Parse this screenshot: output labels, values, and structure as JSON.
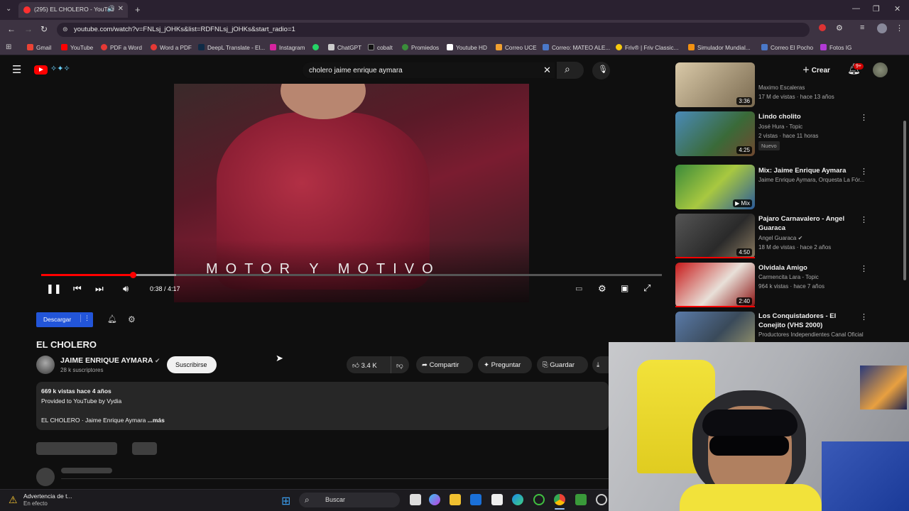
{
  "browser": {
    "tab_title": "(295) EL CHOLERO - YouTub",
    "url": "youtube.com/watch?v=FNLsj_jOHKs&list=RDFNLsj_jOHKs&start_radio=1",
    "bookmarks": [
      "Gmail",
      "YouTube",
      "PDF a Word",
      "Word a PDF",
      "DeepL Translate - El...",
      "Instagram",
      "ChatGPT",
      "cobalt",
      "Promiedos",
      "Youtube HD",
      "Correo UCE",
      "Correo: MATEO ALE...",
      "Friv® | Friv Classic...",
      "Simulador Mundial...",
      "Correo El Pocho",
      "Fotos IG"
    ]
  },
  "yt": {
    "search_query": "cholero jaime enrique aymara",
    "create_label": "Crear",
    "notif_count": "9+"
  },
  "player": {
    "overlay_text": "MOTOR Y MOTIVO",
    "time": "0:38 / 4:17",
    "progress_fraction": 0.148
  },
  "video": {
    "download_label": "Descargar",
    "title": "EL CHOLERO",
    "channel": "JAIME ENRIQUE AYMARA",
    "subscribers": "28 k suscriptores",
    "subscribe_label": "Suscribirse",
    "likes": "3.4 K",
    "share_label": "Compartir",
    "ask_label": "Preguntar",
    "save_label": "Guardar",
    "views_date": "669 k vistas  hace 4 años",
    "provided": "Provided to YouTube by Vydia",
    "desc_line": "EL CHOLERO · Jaime Enrique Aymara",
    "more_label": "...más"
  },
  "sidebar": [
    {
      "title": "",
      "channel": "Maximo Escaleras",
      "meta": "17 M de vistas · hace 13 años",
      "duration": "3:36",
      "badge": ""
    },
    {
      "title": "Lindo cholito",
      "channel": "José Hura - Topic",
      "meta": "2 vistas · hace 11 horas",
      "duration": "4:25",
      "badge": "Nuevo"
    },
    {
      "title": "Mix: Jaime Enrique Aymara",
      "channel": "Jaime Enrique Aymara, Orquesta La Fór...",
      "meta": "",
      "duration": "Mix",
      "badge": ""
    },
    {
      "title": "Pajaro Carnavalero - Angel Guaraca",
      "channel": "Angel Guaraca",
      "meta": "18 M de vistas · hace 2 años",
      "duration": "4:50",
      "badge": ""
    },
    {
      "title": "Olvidala Amigo",
      "channel": "Carmencita Lara - Topic",
      "meta": "964 k vistas · hace 7 años",
      "duration": "2:40",
      "badge": ""
    },
    {
      "title": "Los Conquistadores - El Conejito (VHS 2000)",
      "channel": "Productores Independientes Canal Oficial",
      "meta": "",
      "duration": "",
      "badge": ""
    }
  ],
  "taskbar": {
    "warning_title": "Advertencia de t...",
    "warning_sub": "En efecto",
    "search_label": "Buscar"
  }
}
